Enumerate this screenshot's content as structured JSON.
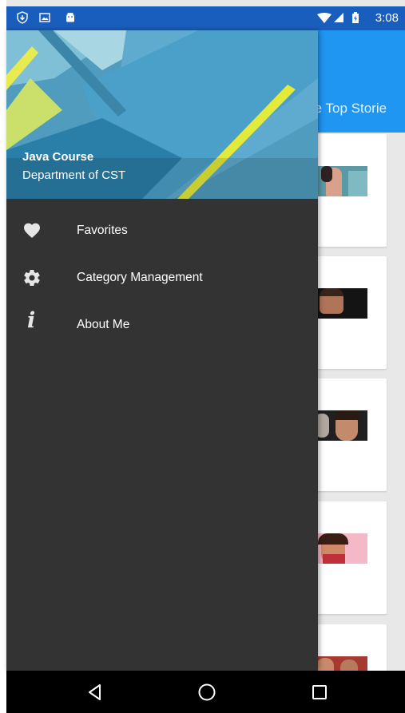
{
  "app": {
    "tab_label": "re Top Storie"
  },
  "status_bar": {
    "time": "3:08",
    "left_icons": [
      "shield-download-icon",
      "image-notification-icon",
      "android-icon"
    ],
    "right_icons": [
      "wifi-icon",
      "cellular-signal-icon",
      "battery-icon"
    ]
  },
  "drawer": {
    "header": {
      "title": "Java Course",
      "subtitle": "Department of CST"
    },
    "items": [
      {
        "label": "Favorites",
        "icon": "heart-icon"
      },
      {
        "label": "Category Management",
        "icon": "gear-icon"
      },
      {
        "label": "About Me",
        "icon": "info-icon"
      }
    ]
  },
  "nav_bar": {
    "buttons": [
      "back-icon",
      "home-icon",
      "recents-icon"
    ]
  },
  "colors": {
    "status_bar": "#1a5ebd",
    "app_bar": "#1e96f2",
    "drawer_background": "#333333",
    "navigation_bar": "#000000"
  }
}
